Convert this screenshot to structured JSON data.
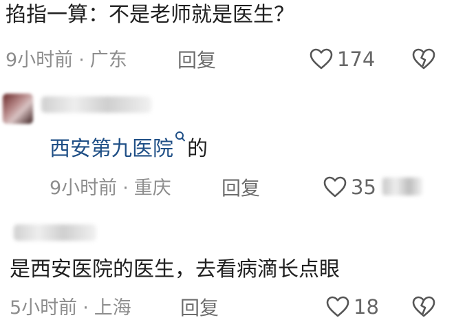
{
  "comments": [
    {
      "text": "掐指一算：不是老师就是医生？",
      "time": "9小时前",
      "location": "广东",
      "reply_label": "回复",
      "likes": "174"
    },
    {
      "link_text": "西安第九医院",
      "text_suffix": "的",
      "time": "9小时前",
      "location": "重庆",
      "reply_label": "回复",
      "likes": "35"
    },
    {
      "text": "是西安医院的医生，去看病滴长点眼",
      "time": "5小时前",
      "location": "上海",
      "reply_label": "回复",
      "likes": "18"
    }
  ],
  "meta_separator": "·",
  "icons": {
    "like": "heart-outline-icon",
    "dislike": "broken-heart-icon",
    "search": "search-icon"
  },
  "colors": {
    "link": "#1f4f86",
    "meta": "#8d8d8d",
    "text": "#1f1f1f"
  }
}
